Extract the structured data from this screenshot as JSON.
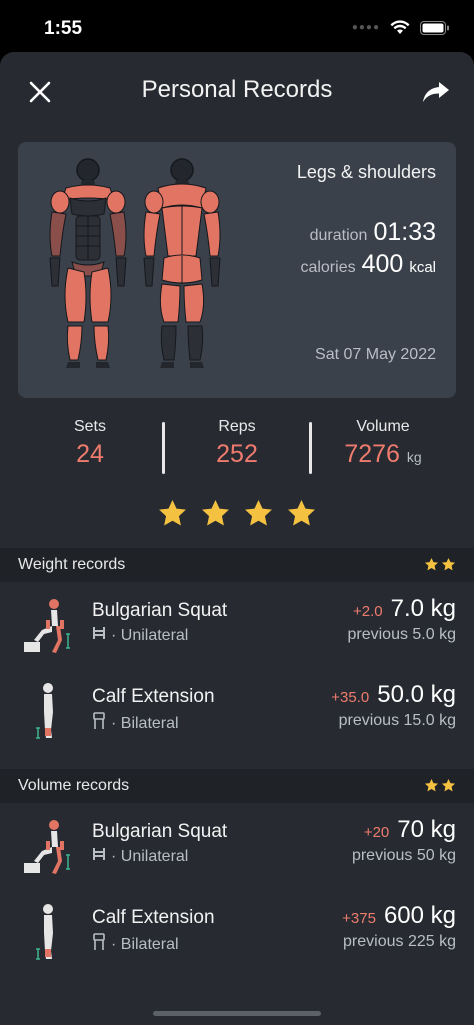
{
  "status": {
    "time": "1:55"
  },
  "nav": {
    "title": "Personal Records"
  },
  "summary": {
    "workout_name": "Legs & shoulders",
    "duration_label": "duration",
    "duration_value": "01:33",
    "calories_label": "calories",
    "calories_value": "400",
    "calories_unit": "kcal",
    "date": "Sat 07 May 2022"
  },
  "stats": {
    "sets_label": "Sets",
    "sets_value": "24",
    "reps_label": "Reps",
    "reps_value": "252",
    "volume_label": "Volume",
    "volume_value": "7276",
    "volume_unit": "kg"
  },
  "rating": {
    "stars": 4,
    "star_color": "#f4c141"
  },
  "weight_records": {
    "title": "Weight records",
    "stars": 2,
    "items": [
      {
        "name": "Bulgarian Squat",
        "type": "Unilateral",
        "delta": "+2.0",
        "value": "7.0 kg",
        "previous": "previous 5.0 kg",
        "icon": "bulgarian-squat-icon"
      },
      {
        "name": "Calf Extension",
        "type": "Bilateral",
        "delta": "+35.0",
        "value": "50.0 kg",
        "previous": "previous 15.0 kg",
        "icon": "calf-extension-icon"
      }
    ]
  },
  "volume_records": {
    "title": "Volume records",
    "stars": 2,
    "items": [
      {
        "name": "Bulgarian Squat",
        "type": "Unilateral",
        "delta": "+20",
        "value": "70 kg",
        "previous": "previous 50 kg",
        "icon": "bulgarian-squat-icon"
      },
      {
        "name": "Calf Extension",
        "type": "Bilateral",
        "delta": "+375",
        "value": "600 kg",
        "previous": "previous 225 kg",
        "icon": "calf-extension-icon"
      }
    ]
  },
  "colors": {
    "accent": "#ef7b6e",
    "background": "#272b31",
    "card": "#3a414b",
    "section": "#1f2227",
    "muscle": "#e27463",
    "muscle_dim": "#8a4f4a"
  }
}
